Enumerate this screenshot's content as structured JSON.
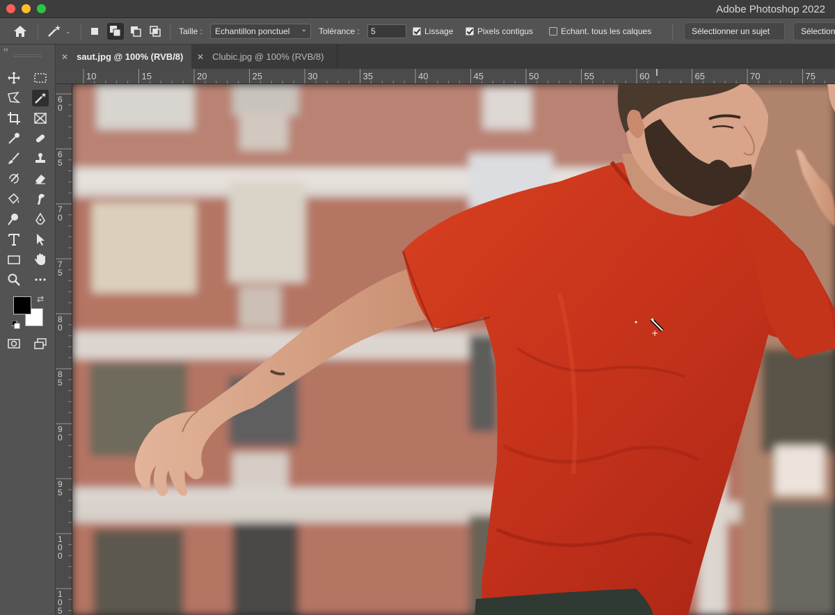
{
  "window": {
    "title": "Adobe Photoshop 2022"
  },
  "options_bar": {
    "size_label": "Taille :",
    "size_value": "Echantillon ponctuel",
    "tolerance_label": "Tolérance :",
    "tolerance_value": "5",
    "antialias_label": "Lissage",
    "antialias_checked": true,
    "contiguous_label": "Pixels contigus",
    "contiguous_checked": true,
    "sample_all_label": "Echant. tous les calques",
    "sample_all_checked": false,
    "select_subject_label": "Sélectionner un sujet",
    "select_mask_label": "Sélection"
  },
  "tabs": [
    {
      "label": "saut.jpg @ 100% (RVB/8)",
      "active": true
    },
    {
      "label": "Clubic.jpg @ 100% (RVB/8)",
      "active": false
    }
  ],
  "ruler": {
    "horizontal_ticks": [
      "10",
      "15",
      "20",
      "25",
      "30",
      "35",
      "40",
      "45",
      "50",
      "55",
      "60",
      "65",
      "70",
      "75"
    ],
    "vertical_ticks": [
      "60",
      "65",
      "70",
      "75",
      "80",
      "85",
      "90",
      "95",
      "100",
      "105"
    ]
  },
  "toolbar": {
    "tools": [
      "move-tool",
      "marquee-tool",
      "lasso-tool",
      "magic-wand-tool",
      "crop-tool",
      "frame-tool",
      "eyedropper-tool",
      "healing-brush-tool",
      "brush-tool",
      "clone-stamp-tool",
      "history-brush-tool",
      "eraser-tool",
      "paint-bucket-tool",
      "smudge-tool",
      "dodge-tool",
      "pen-tool",
      "type-tool",
      "path-selection-tool",
      "rectangle-tool",
      "hand-tool",
      "zoom-tool",
      "more-tools"
    ],
    "foreground_color": "#000000",
    "background_color": "#ffffff"
  },
  "colors": {
    "shirt": "#c8321c",
    "brick": "#b06a5a",
    "chrome": "#535353"
  }
}
